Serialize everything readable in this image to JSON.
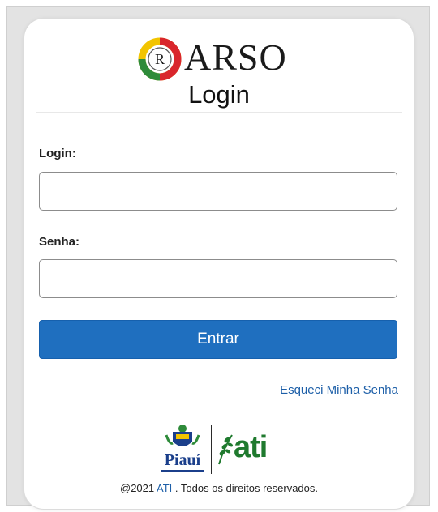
{
  "logo": {
    "emblem_letter": "R",
    "text": "ARSO",
    "colors": {
      "red": "#d9262c",
      "yellow": "#f2c400",
      "green": "#2e8b3a"
    }
  },
  "title": "Login",
  "form": {
    "login_label": "Login:",
    "login_value": "",
    "senha_label": "Senha:",
    "senha_value": "",
    "submit_label": "Entrar",
    "forgot_label": "Esqueci Minha Senha"
  },
  "partners": {
    "piaui_word": "Piauí",
    "ati_word": "ati",
    "piaui_icon": "coat-of-arms-icon",
    "ati_icon": "leaf-icon"
  },
  "footer": {
    "prefix": "@2021",
    "link": "ATI",
    "suffix": ". Todos os direitos reservados."
  },
  "colors": {
    "primary": "#1f6fbf",
    "link": "#1d5fa8",
    "ati_green": "#1f7a2e",
    "piaui_blue": "#1b3f8b"
  }
}
